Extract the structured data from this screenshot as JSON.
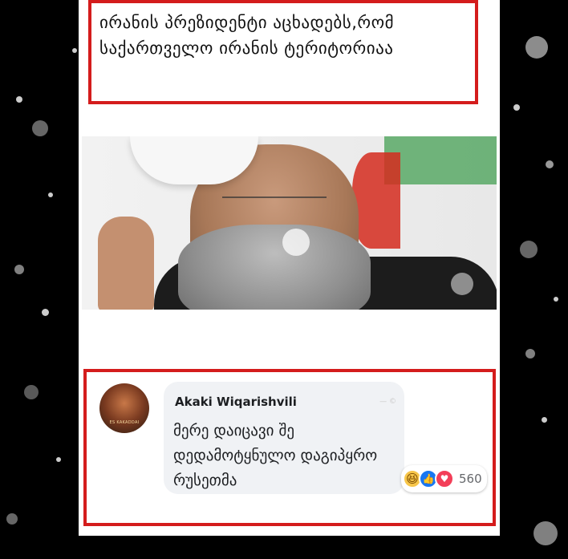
{
  "post": {
    "headline": "ირანის პრეზიდენტი აცხადებს,რომ საქართველო ირანის ტერიტორიაა"
  },
  "comment": {
    "author": "Akaki Wiqarishvili",
    "avatar_text": "ES KAKADDAI",
    "text": "მერე დაიცავი შე დედამოტყნულო დაგიპყრო რუსეთმა",
    "watermark": "— © "
  },
  "reactions": {
    "icons": [
      "haha-emoji",
      "like-emoji",
      "love-emoji"
    ],
    "count": "560",
    "colors": {
      "haha": "#f7c64a",
      "like": "#1877f2",
      "love": "#f33e58"
    }
  },
  "accent_color": "#d41c1c"
}
